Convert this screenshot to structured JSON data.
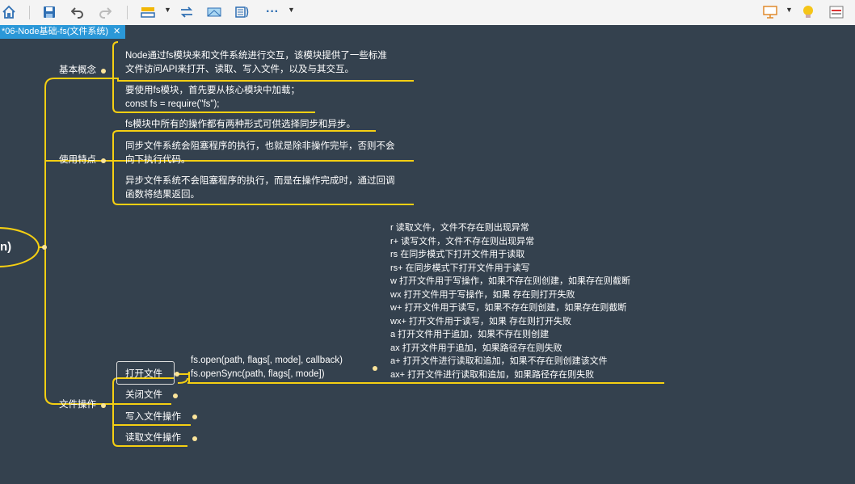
{
  "toolbar": {
    "icons": [
      "home-icon",
      "save-icon",
      "undo-icon",
      "redo-icon",
      "insert-topic-icon",
      "relationship-icon",
      "boundary-icon",
      "summary-icon",
      "more-icon",
      "presentation-icon",
      "idea-icon",
      "panel-icon"
    ]
  },
  "tab": {
    "title": "*06-Node基础-fs(文件系统)",
    "close": "✕"
  },
  "root": {
    "label": "n)"
  },
  "branches": {
    "basic": "基本概念",
    "usage": "使用特点",
    "fileops": "文件操作"
  },
  "basic_items": {
    "p1_line1": "Node通过fs模块来和文件系统进行交互，该模块提供了一些标准",
    "p1_line2": "文件访问API来打开、读取、写入文件，以及与其交互。",
    "p2_line1": "要使用fs模块，首先要从核心模块中加载；",
    "p2_line2": "const fs = require(\"fs\");"
  },
  "usage_items": {
    "u0": "fs模块中所有的操作都有两种形式可供选择同步和异步。",
    "u1_line1": "同步文件系统会阻塞程序的执行，也就是除非操作完毕，否则不会",
    "u1_line2": "向下执行代码。",
    "u2_line1": "异步文件系统不会阻塞程序的执行，而是在操作完成时，通过回调",
    "u2_line2": "函数将结果返回。"
  },
  "fileops_items": {
    "open": "打开文件",
    "close": "关闭文件",
    "write": "写入文件操作",
    "read": "读取文件操作"
  },
  "open_api": {
    "async": "fs.open(path, flags[, mode], callback)",
    "sync": "fs.openSync(path, flags[, mode])"
  },
  "flags": [
    "r 读取文件，文件不存在则出现异常",
    "r+ 读写文件，文件不存在则出现异常",
    "rs 在同步模式下打开文件用于读取",
    "rs+ 在同步模式下打开文件用于读写",
    "w 打开文件用于写操作，如果不存在则创建，如果存在则截断",
    "wx 打开文件用于写操作，如果 存在则打开失败",
    "w+ 打开文件用于读写，如果不存在则创建，如果存在则截断",
    "wx+ 打开文件用于读写，如果 存在则打开失败",
    "a 打开文件用于追加，如果不存在则创建",
    "ax 打开文件用于追加，如果路径存在则失败",
    "a+ 打开文件进行读取和追加，如果不存在则创建该文件",
    "ax+ 打开文件进行读取和追加，如果路径存在则失败"
  ],
  "colors": {
    "line": "#f5cf12",
    "bg": "#34414e",
    "tab": "#2b98d8"
  }
}
